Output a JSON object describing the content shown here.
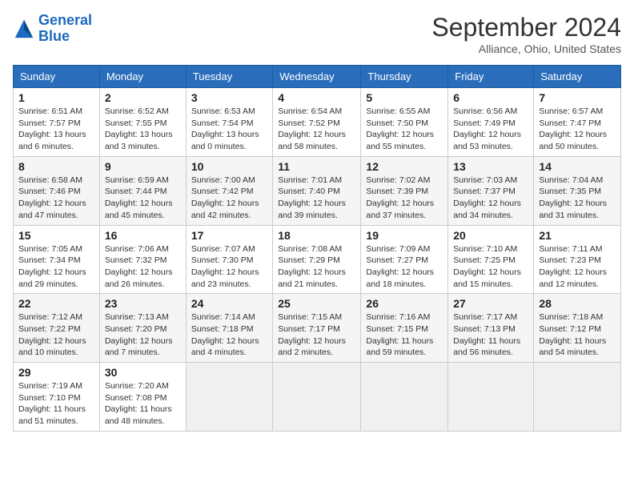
{
  "header": {
    "logo_general": "General",
    "logo_blue": "Blue",
    "month": "September 2024",
    "location": "Alliance, Ohio, United States"
  },
  "days_of_week": [
    "Sunday",
    "Monday",
    "Tuesday",
    "Wednesday",
    "Thursday",
    "Friday",
    "Saturday"
  ],
  "weeks": [
    [
      {
        "day": "1",
        "sunrise": "6:51 AM",
        "sunset": "7:57 PM",
        "daylight": "13 hours and 6 minutes."
      },
      {
        "day": "2",
        "sunrise": "6:52 AM",
        "sunset": "7:55 PM",
        "daylight": "13 hours and 3 minutes."
      },
      {
        "day": "3",
        "sunrise": "6:53 AM",
        "sunset": "7:54 PM",
        "daylight": "13 hours and 0 minutes."
      },
      {
        "day": "4",
        "sunrise": "6:54 AM",
        "sunset": "7:52 PM",
        "daylight": "12 hours and 58 minutes."
      },
      {
        "day": "5",
        "sunrise": "6:55 AM",
        "sunset": "7:50 PM",
        "daylight": "12 hours and 55 minutes."
      },
      {
        "day": "6",
        "sunrise": "6:56 AM",
        "sunset": "7:49 PM",
        "daylight": "12 hours and 53 minutes."
      },
      {
        "day": "7",
        "sunrise": "6:57 AM",
        "sunset": "7:47 PM",
        "daylight": "12 hours and 50 minutes."
      }
    ],
    [
      {
        "day": "8",
        "sunrise": "6:58 AM",
        "sunset": "7:46 PM",
        "daylight": "12 hours and 47 minutes."
      },
      {
        "day": "9",
        "sunrise": "6:59 AM",
        "sunset": "7:44 PM",
        "daylight": "12 hours and 45 minutes."
      },
      {
        "day": "10",
        "sunrise": "7:00 AM",
        "sunset": "7:42 PM",
        "daylight": "12 hours and 42 minutes."
      },
      {
        "day": "11",
        "sunrise": "7:01 AM",
        "sunset": "7:40 PM",
        "daylight": "12 hours and 39 minutes."
      },
      {
        "day": "12",
        "sunrise": "7:02 AM",
        "sunset": "7:39 PM",
        "daylight": "12 hours and 37 minutes."
      },
      {
        "day": "13",
        "sunrise": "7:03 AM",
        "sunset": "7:37 PM",
        "daylight": "12 hours and 34 minutes."
      },
      {
        "day": "14",
        "sunrise": "7:04 AM",
        "sunset": "7:35 PM",
        "daylight": "12 hours and 31 minutes."
      }
    ],
    [
      {
        "day": "15",
        "sunrise": "7:05 AM",
        "sunset": "7:34 PM",
        "daylight": "12 hours and 29 minutes."
      },
      {
        "day": "16",
        "sunrise": "7:06 AM",
        "sunset": "7:32 PM",
        "daylight": "12 hours and 26 minutes."
      },
      {
        "day": "17",
        "sunrise": "7:07 AM",
        "sunset": "7:30 PM",
        "daylight": "12 hours and 23 minutes."
      },
      {
        "day": "18",
        "sunrise": "7:08 AM",
        "sunset": "7:29 PM",
        "daylight": "12 hours and 21 minutes."
      },
      {
        "day": "19",
        "sunrise": "7:09 AM",
        "sunset": "7:27 PM",
        "daylight": "12 hours and 18 minutes."
      },
      {
        "day": "20",
        "sunrise": "7:10 AM",
        "sunset": "7:25 PM",
        "daylight": "12 hours and 15 minutes."
      },
      {
        "day": "21",
        "sunrise": "7:11 AM",
        "sunset": "7:23 PM",
        "daylight": "12 hours and 12 minutes."
      }
    ],
    [
      {
        "day": "22",
        "sunrise": "7:12 AM",
        "sunset": "7:22 PM",
        "daylight": "12 hours and 10 minutes."
      },
      {
        "day": "23",
        "sunrise": "7:13 AM",
        "sunset": "7:20 PM",
        "daylight": "12 hours and 7 minutes."
      },
      {
        "day": "24",
        "sunrise": "7:14 AM",
        "sunset": "7:18 PM",
        "daylight": "12 hours and 4 minutes."
      },
      {
        "day": "25",
        "sunrise": "7:15 AM",
        "sunset": "7:17 PM",
        "daylight": "12 hours and 2 minutes."
      },
      {
        "day": "26",
        "sunrise": "7:16 AM",
        "sunset": "7:15 PM",
        "daylight": "11 hours and 59 minutes."
      },
      {
        "day": "27",
        "sunrise": "7:17 AM",
        "sunset": "7:13 PM",
        "daylight": "11 hours and 56 minutes."
      },
      {
        "day": "28",
        "sunrise": "7:18 AM",
        "sunset": "7:12 PM",
        "daylight": "11 hours and 54 minutes."
      }
    ],
    [
      {
        "day": "29",
        "sunrise": "7:19 AM",
        "sunset": "7:10 PM",
        "daylight": "11 hours and 51 minutes."
      },
      {
        "day": "30",
        "sunrise": "7:20 AM",
        "sunset": "7:08 PM",
        "daylight": "11 hours and 48 minutes."
      },
      null,
      null,
      null,
      null,
      null
    ]
  ]
}
